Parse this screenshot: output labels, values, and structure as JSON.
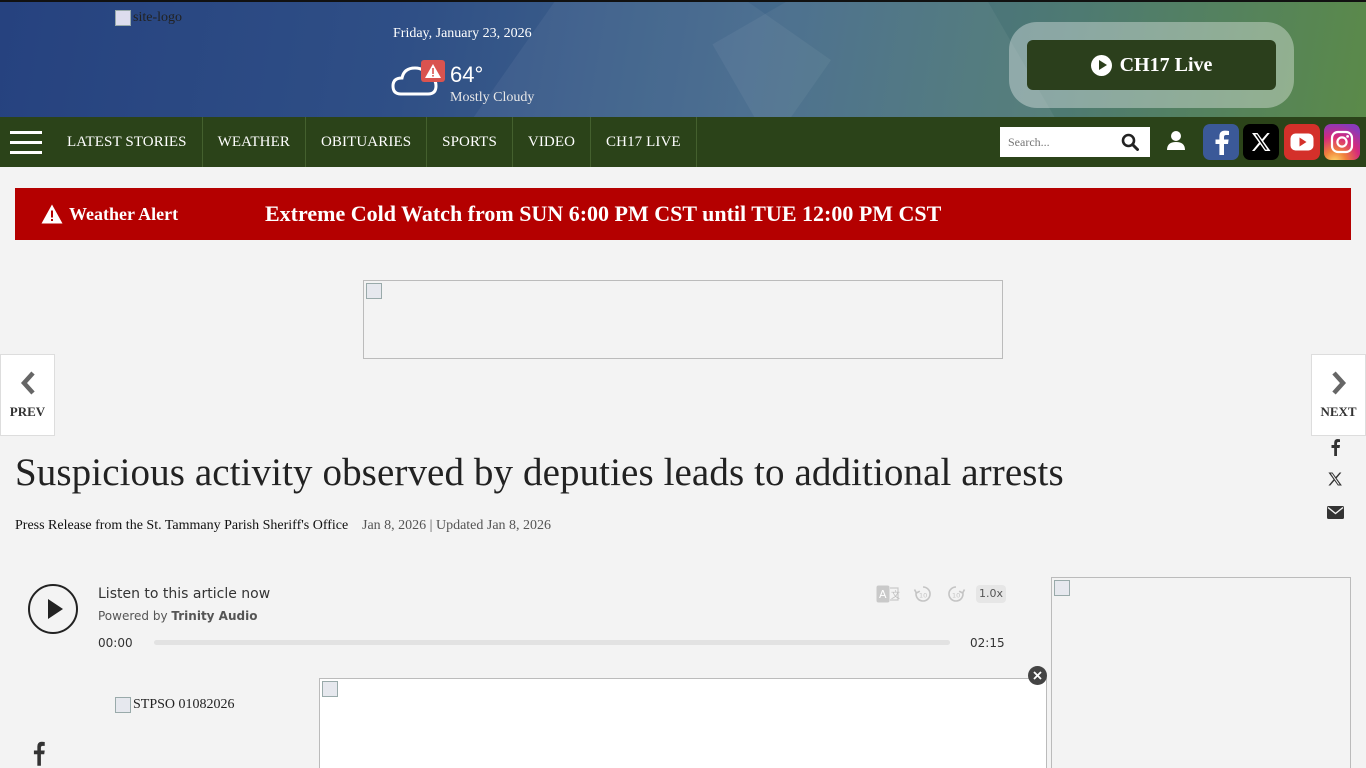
{
  "header": {
    "logo_alt": "site-logo",
    "date": "Friday, January 23, 2026",
    "weather": {
      "temp": "64°",
      "condition": "Mostly Cloudy"
    },
    "live_button": "CH17 Live"
  },
  "nav": {
    "items": [
      "LATEST STORIES",
      "WEATHER",
      "OBITUARIES",
      "SPORTS",
      "VIDEO",
      "CH17 LIVE"
    ],
    "search_placeholder": "Search..."
  },
  "alert": {
    "label": "Weather Alert",
    "message": "Extreme Cold Watch from SUN 6:00 PM CST until TUE 12:00 PM CST"
  },
  "pager": {
    "prev": "PREV",
    "next": "NEXT"
  },
  "article": {
    "headline": "Suspicious activity observed by deputies leads to additional arrests",
    "byline": "Press Release from the St. Tammany Parish Sheriff's Office",
    "dates": "Jan 8, 2026 | Updated Jan 8, 2026",
    "image_alt": "STPSO 01082026"
  },
  "audio": {
    "title": "Listen to this article now",
    "powered_prefix": "Powered by",
    "powered_brand": "Trinity Audio",
    "current_time": "00:00",
    "duration": "02:15",
    "speed": "1.0x"
  },
  "colors": {
    "nav": "#2b4319",
    "alert": "#b40000",
    "live_button": "#2b3f1c"
  }
}
